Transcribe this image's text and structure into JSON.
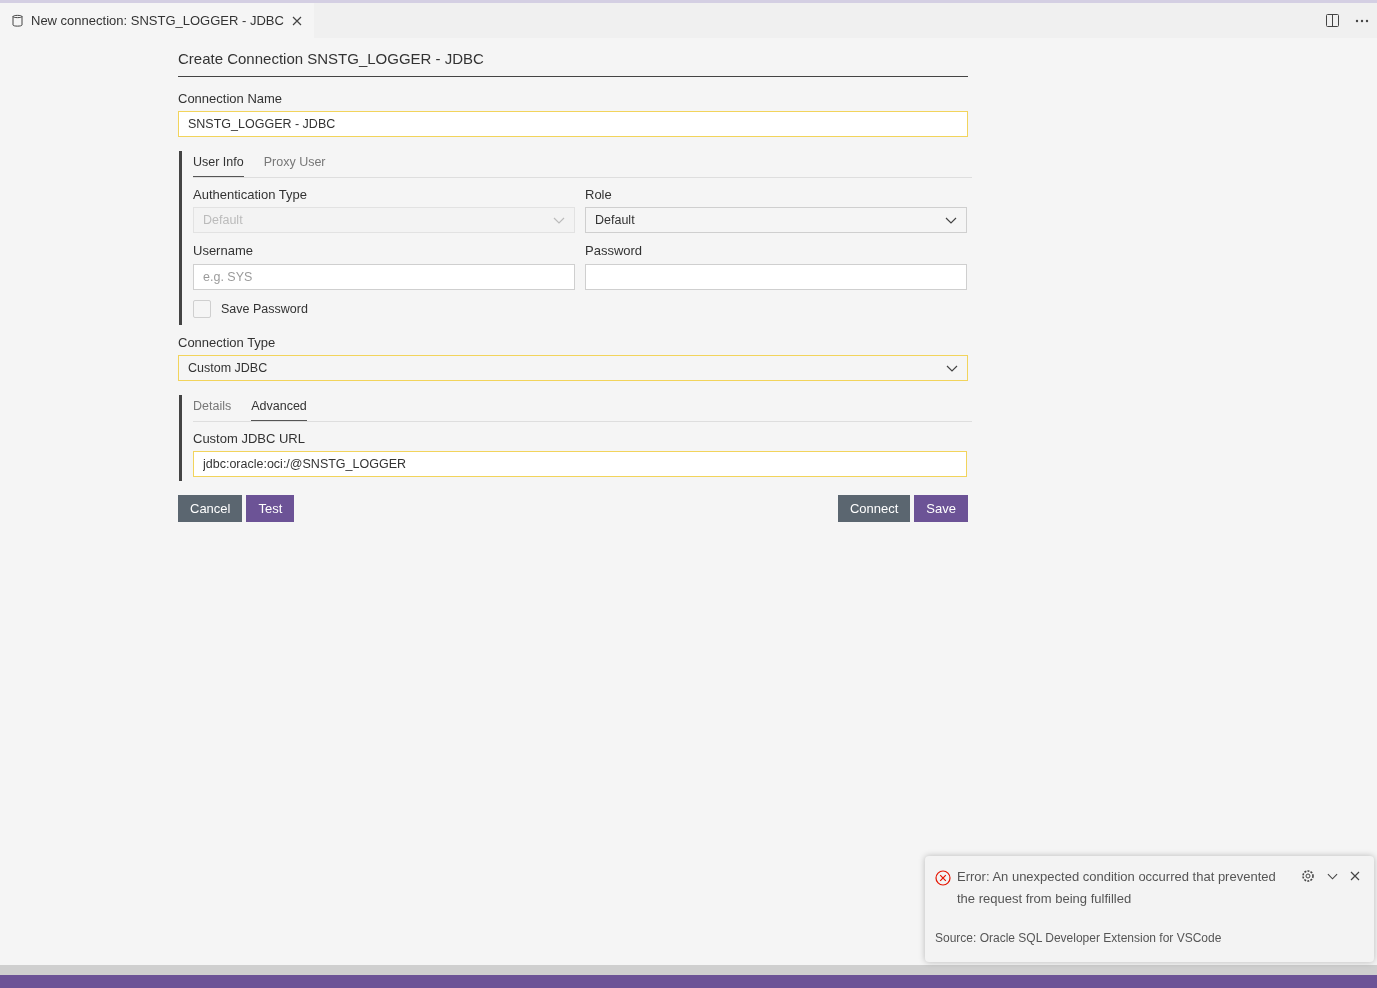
{
  "editor_tab": {
    "title": "New connection: SNSTG_LOGGER - JDBC"
  },
  "form": {
    "heading": "Create Connection SNSTG_LOGGER - JDBC",
    "connection_name": {
      "label": "Connection Name",
      "value": "SNSTG_LOGGER - JDBC",
      "highlighted": true
    },
    "user_tabs": [
      {
        "label": "User Info",
        "selected": true
      },
      {
        "label": "Proxy User",
        "selected": false
      }
    ],
    "fields": [
      {
        "kind": "select",
        "label": "Authentication Type",
        "value": "Default",
        "disabled": true
      },
      {
        "kind": "select",
        "label": "Role",
        "value": "Default",
        "disabled": false
      },
      {
        "kind": "input",
        "label": "Username",
        "placeholder": "e.g. SYS"
      },
      {
        "kind": "input",
        "label": "Password"
      }
    ],
    "save_password": {
      "label": "Save Password",
      "checked": false
    },
    "connection_type": {
      "label": "Connection Type",
      "value": "Custom JDBC",
      "highlighted": true
    },
    "type_tabs": [
      {
        "label": "Details",
        "selected": false
      },
      {
        "label": "Advanced",
        "selected": true
      }
    ],
    "url": {
      "label": "Custom JDBC URL",
      "value": "jdbc:oracle:oci:/@SNSTG_LOGGER",
      "highlighted": true
    },
    "buttons_left": [
      {
        "label": "Cancel",
        "kind": "secondary"
      },
      {
        "label": "Test",
        "kind": "primary"
      }
    ],
    "buttons_right": [
      {
        "label": "Connect",
        "kind": "secondary"
      },
      {
        "label": "Save",
        "kind": "primary"
      }
    ]
  },
  "notification": {
    "message": "Error: An unexpected condition occurred that prevented the request from being fulfilled",
    "source": "Source: Oracle SQL Developer Extension for VSCode"
  }
}
